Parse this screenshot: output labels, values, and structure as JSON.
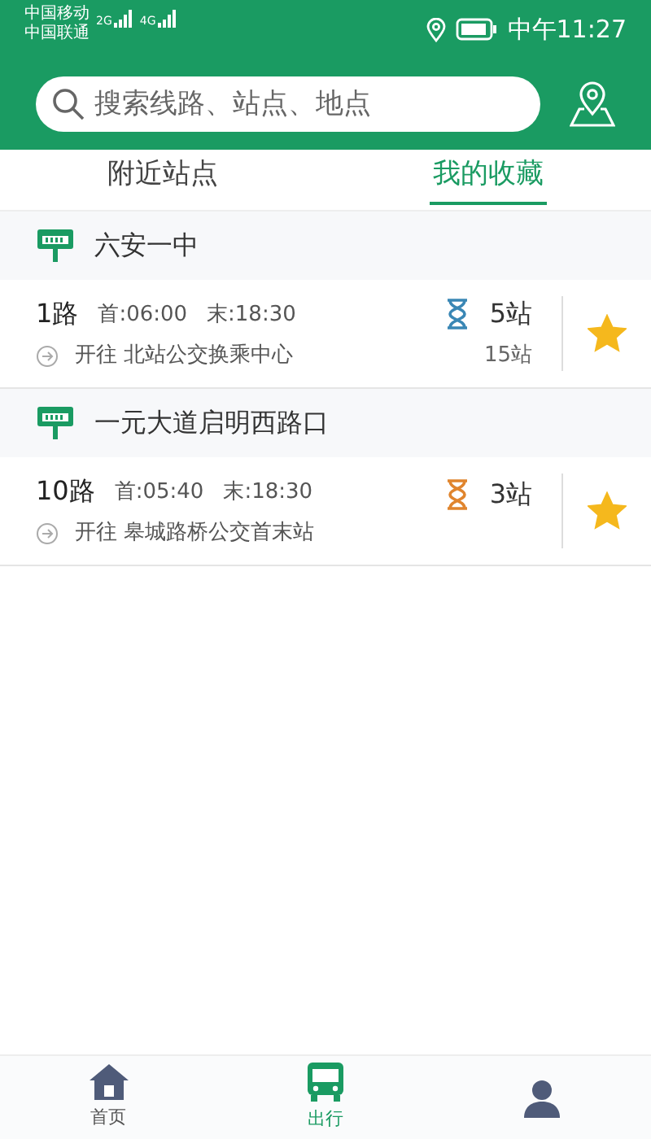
{
  "status_bar": {
    "carriers": [
      "中国移动",
      "中国联通"
    ],
    "network_types": [
      "2G",
      "4G"
    ],
    "time": "中午11:27"
  },
  "search": {
    "placeholder": "搜索线路、站点、地点"
  },
  "tabs": [
    {
      "label": "附近站点",
      "selected": false
    },
    {
      "label": "我的收藏",
      "selected": true
    }
  ],
  "stations": [
    {
      "name": "六安一中",
      "routes": [
        {
          "line": "1路",
          "first": "首:06:00",
          "last": "末:18:30",
          "direction": "开往 北站公交换乘中心",
          "eta": "5站",
          "color": "#3a87b5",
          "stops": "15站",
          "favorited": true
        }
      ]
    },
    {
      "name": "一元大道启明西路口",
      "routes": [
        {
          "line": "10路",
          "first": "首:05:40",
          "last": "末:18:30",
          "direction": "开往 皋城路桥公交首末站",
          "eta": "3站",
          "color": "#e0852e",
          "favorited": true
        }
      ]
    }
  ],
  "bottom_nav": [
    {
      "kind": "home",
      "label": "首页",
      "selected": false
    },
    {
      "kind": "bus",
      "label": "出行",
      "selected": true
    },
    {
      "kind": "user",
      "selected": false
    }
  ]
}
